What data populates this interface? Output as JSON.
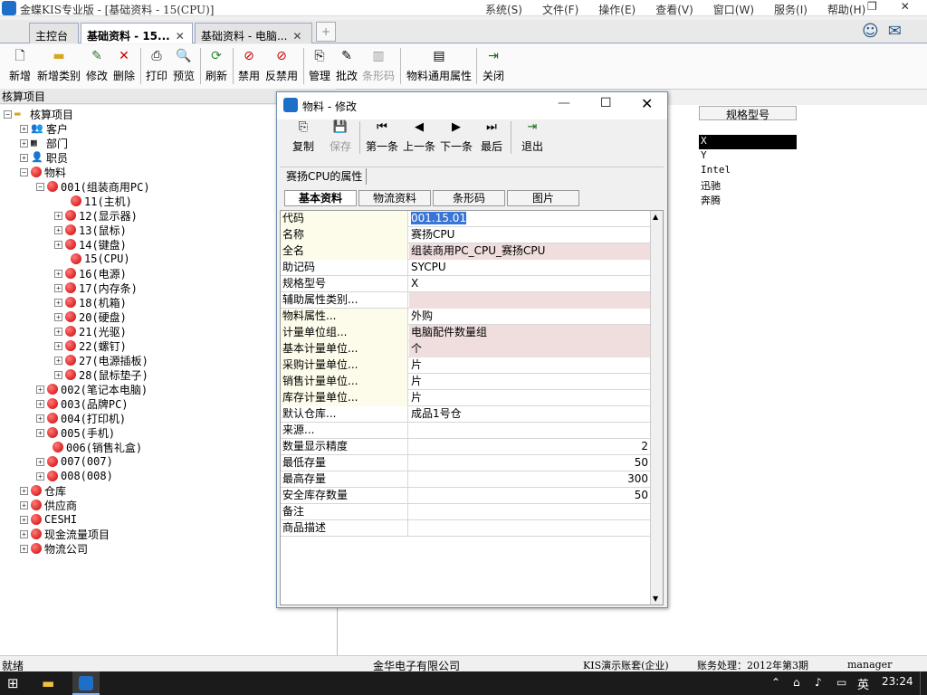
{
  "titlebar": {
    "title": "金蝶KIS专业版 - [基础资料 - 15(CPU)]"
  },
  "menu": [
    "系统(S)",
    "文件(F)",
    "操作(E)",
    "查看(V)",
    "窗口(W)",
    "服务(I)",
    "帮助(H)"
  ],
  "tabs": [
    {
      "label": "主控台"
    },
    {
      "label": "基础资料 - 15..."
    },
    {
      "label": "基础资料 - 电脑..."
    }
  ],
  "toolbar": [
    "新增",
    "新增类别",
    "修改",
    "删除",
    "打印",
    "预览",
    "刷新",
    "禁用",
    "反禁用",
    "管理",
    "批改",
    "条形码",
    "物料通用属性",
    "关闭"
  ],
  "left_panel": {
    "header": "核算项目"
  },
  "tree": [
    "核算项目",
    "客户",
    "部门",
    "职员",
    "物料",
    "001(组装商用PC)",
    "11(主机)",
    "12(显示器)",
    "13(鼠标)",
    "14(键盘)",
    "15(CPU)",
    "16(电源)",
    "17(内存条)",
    "18(机箱)",
    "20(硬盘)",
    "21(光驱)",
    "22(螺钉)",
    "27(电源插板)",
    "28(鼠标垫子)",
    "002(笔记本电脑)",
    "003(品牌PC)",
    "004(打印机)",
    "005(手机)",
    "006(销售礼盒)",
    "007(007)",
    "008(008)",
    "仓库",
    "供应商",
    "CESHI",
    "现金流量项目",
    "物流公司"
  ],
  "right_table": {
    "header": "规格型号",
    "cells": [
      "X",
      "Y",
      "Intel",
      "迅驰",
      "奔腾"
    ]
  },
  "dialog": {
    "title": "物料 - 修改",
    "buttons": [
      "复制",
      "保存",
      "第一条",
      "上一条",
      "下一条",
      "最后",
      "退出"
    ],
    "group_tab": "赛扬CPU的属性",
    "subtabs": [
      "基本资料",
      "物流资料",
      "条形码",
      "图片"
    ],
    "fields": [
      {
        "label": "代码",
        "value": "001.15.01"
      },
      {
        "label": "名称",
        "value": "赛扬CPU"
      },
      {
        "label": "全名",
        "value": "组装商用PC_CPU_赛扬CPU"
      },
      {
        "label": "助记码",
        "value": "SYCPU"
      },
      {
        "label": "规格型号",
        "value": "X"
      },
      {
        "label": "辅助属性类别...",
        "value": ""
      },
      {
        "label": "物料属性...",
        "value": "外购"
      },
      {
        "label": "计量单位组...",
        "value": "电脑配件数量组"
      },
      {
        "label": "基本计量单位...",
        "value": "个"
      },
      {
        "label": "采购计量单位...",
        "value": "片"
      },
      {
        "label": "销售计量单位...",
        "value": "片"
      },
      {
        "label": "库存计量单位...",
        "value": "片"
      },
      {
        "label": "默认仓库...",
        "value": "成品1号仓"
      },
      {
        "label": "来源...",
        "value": ""
      },
      {
        "label": "数量显示精度",
        "value": "2"
      },
      {
        "label": "最低存量",
        "value": "50"
      },
      {
        "label": "最高存量",
        "value": "300"
      },
      {
        "label": "安全库存数量",
        "value": "50"
      },
      {
        "label": "备注",
        "value": ""
      },
      {
        "label": "商品描述",
        "value": ""
      }
    ]
  },
  "status": {
    "left": "就绪",
    "company": "金华电子有限公司",
    "account": "KIS演示账套(企业)",
    "period": "账务处理：2012年第3期",
    "user": "manager"
  },
  "taskbar": {
    "lang": "英",
    "time": "23:24"
  }
}
